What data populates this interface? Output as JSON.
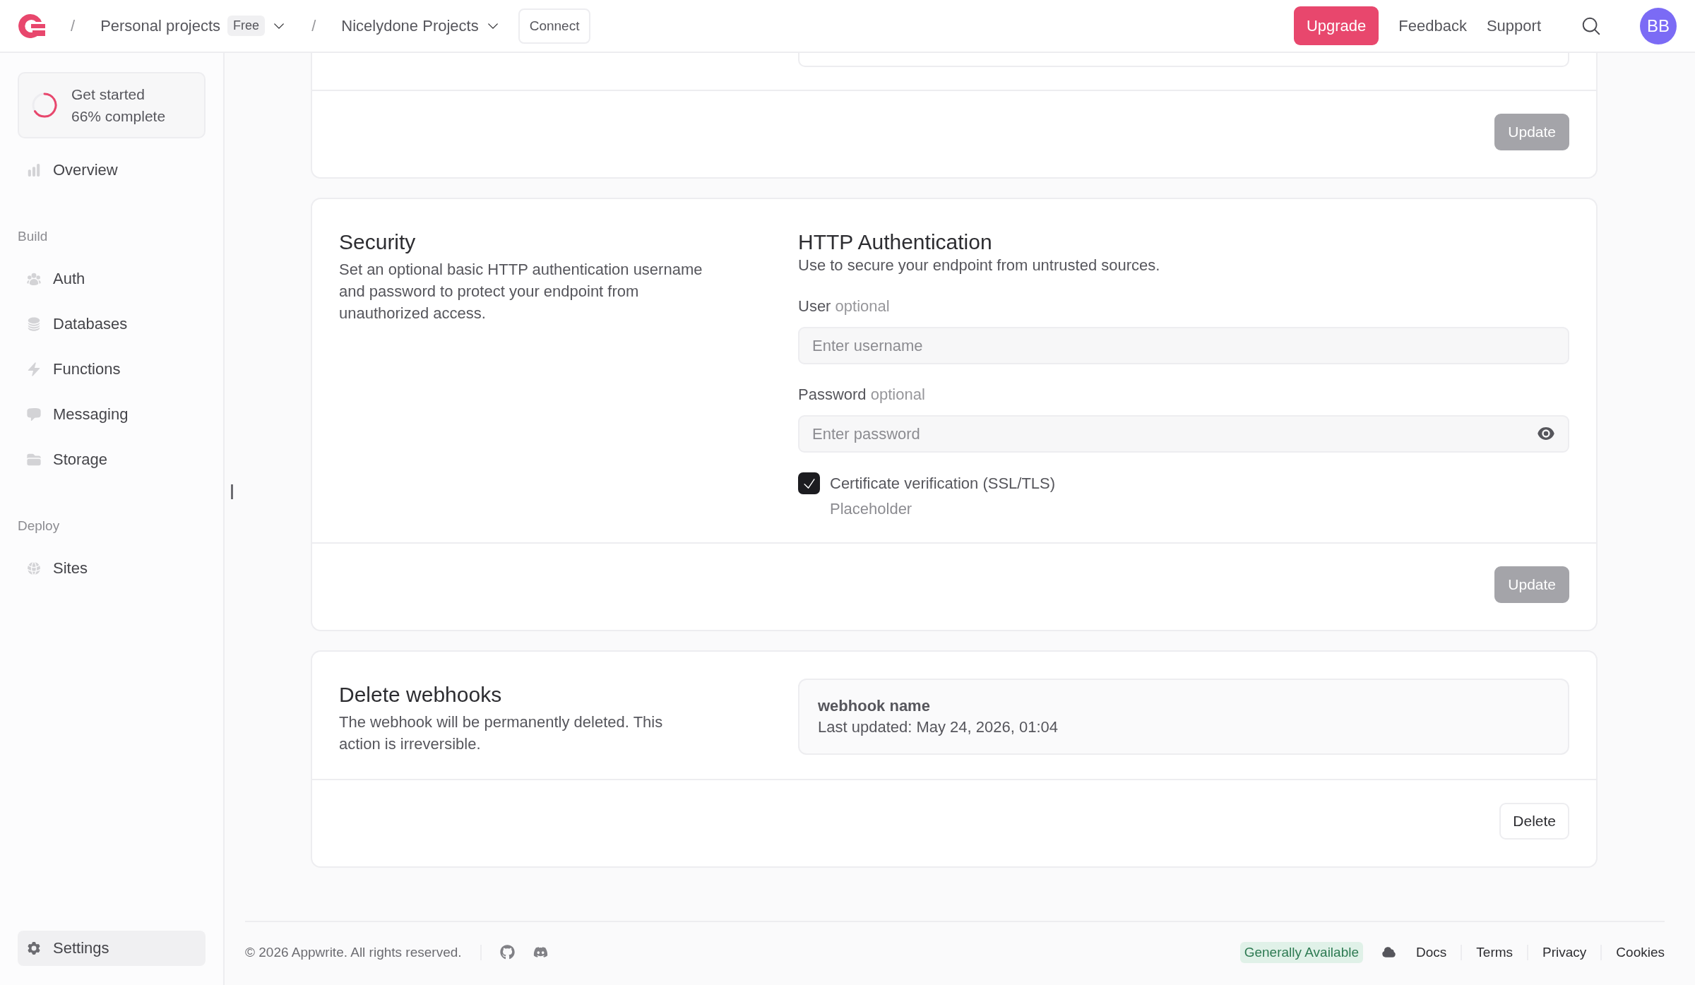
{
  "topbar": {
    "breadcrumbs": [
      {
        "separator": "/",
        "label": "Personal projects",
        "badge": "Free"
      },
      {
        "separator": "/",
        "label": "Nicelydone Projects"
      }
    ],
    "connect": "Connect",
    "upgrade": "Upgrade",
    "links": [
      "Feedback",
      "Support"
    ],
    "avatar": "BB"
  },
  "sidebar": {
    "progress": {
      "title": "Get started",
      "subtitle": "66% complete"
    },
    "sections": [
      {
        "items": [
          {
            "label": "Overview",
            "selected": false
          }
        ]
      },
      {
        "title": "Build",
        "items": [
          {
            "label": "Auth",
            "selected": false
          },
          {
            "label": "Databases",
            "selected": false
          },
          {
            "label": "Functions",
            "selected": false
          },
          {
            "label": "Messaging",
            "selected": false
          },
          {
            "label": "Storage",
            "selected": false
          }
        ]
      },
      {
        "title": "Deploy",
        "items": [
          {
            "label": "Sites",
            "selected": false
          }
        ]
      }
    ],
    "settings": {
      "label": "Settings",
      "selected": true
    }
  },
  "cards": [
    {
      "kind": "partial",
      "button": {
        "label": "Update",
        "disabled": true
      }
    },
    {
      "kind": "form",
      "title": "Security",
      "description": "Set an optional basic HTTP authentication username and password to protect your endpoint from unauthorized access.",
      "panel_title": "HTTP Authentication",
      "panel_description": "Use to secure your endpoint from untrusted sources.",
      "fields": [
        {
          "kind": "text",
          "label": "User",
          "hint": "optional",
          "placeholder": "Enter username"
        },
        {
          "kind": "password",
          "label": "Password",
          "hint": "optional",
          "placeholder": "Enter password"
        }
      ],
      "checkbox": {
        "label": "Certificate verification (SSL/TLS)",
        "description": "Placeholder",
        "checked": true
      },
      "button": {
        "label": "Update",
        "disabled": true
      }
    },
    {
      "kind": "delete",
      "title": "Delete webhooks",
      "description": "The webhook will be permanently deleted. This action is irreversible.",
      "item": {
        "name": "webhook name",
        "meta": "Last updated: May 24, 2026, 01:04"
      },
      "button": {
        "label": "Delete",
        "disabled": false
      }
    }
  ],
  "footer": {
    "copyright": "© 2026 Appwrite. All rights reserved.",
    "status": "Generally Available",
    "links": [
      "Docs",
      "Terms",
      "Privacy",
      "Cookies"
    ]
  }
}
